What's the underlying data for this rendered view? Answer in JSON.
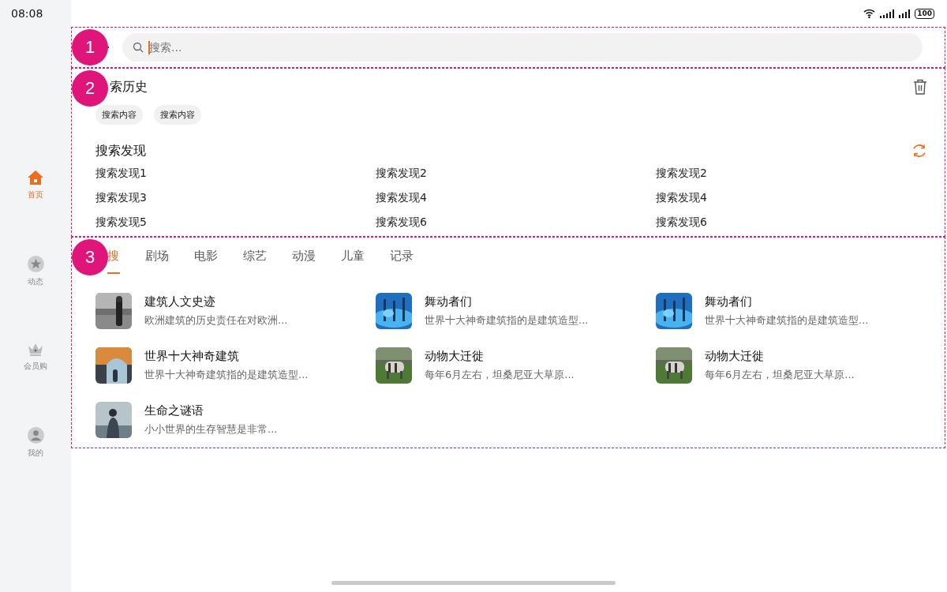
{
  "status_bar": {
    "time": "08:08",
    "battery": "100"
  },
  "sidebar": {
    "items": [
      {
        "label": "首页",
        "kind": "home",
        "selected": true
      },
      {
        "label": "动态",
        "kind": "star",
        "selected": false
      },
      {
        "label": "会员购",
        "kind": "crown",
        "selected": false
      },
      {
        "label": "我的",
        "kind": "user",
        "selected": false
      }
    ]
  },
  "annotations": [
    "1",
    "2",
    "3"
  ],
  "search": {
    "placeholder": "搜索..."
  },
  "history": {
    "title": "索历史",
    "chips": [
      "搜索内容",
      "搜索内容"
    ]
  },
  "discover": {
    "title": "搜索发现",
    "items": [
      "搜索发现1",
      "搜索发现2",
      "搜索发现2",
      "搜索发现3",
      "搜索发现4",
      "搜索发现4",
      "搜索发现5",
      "搜索发现6",
      "搜索发现6"
    ]
  },
  "tabs": [
    {
      "label": "搜",
      "selected": true
    },
    {
      "label": "剧场",
      "selected": false
    },
    {
      "label": "电影",
      "selected": false
    },
    {
      "label": "综艺",
      "selected": false
    },
    {
      "label": "动漫",
      "selected": false
    },
    {
      "label": "儿童",
      "selected": false
    },
    {
      "label": "记录",
      "selected": false
    }
  ],
  "results": [
    {
      "title": "建筑人文史迹",
      "desc": "欧洲建筑的历史责任在对欧洲..."
    },
    {
      "title": "舞动者们",
      "desc": "世界十大神奇建筑指的是建筑造型..."
    },
    {
      "title": "舞动者们",
      "desc": "世界十大神奇建筑指的是建筑造型..."
    },
    {
      "title": "世界十大神奇建筑",
      "desc": "世界十大神奇建筑指的是建筑造型..."
    },
    {
      "title": "动物大迁徙",
      "desc": "每年6月左右，坦桑尼亚大草原..."
    },
    {
      "title": "动物大迁徙",
      "desc": "每年6月左右，坦桑尼亚大草原..."
    },
    {
      "title": "生命之谜语",
      "desc": "小小世界的生存智慧是非常..."
    }
  ]
}
